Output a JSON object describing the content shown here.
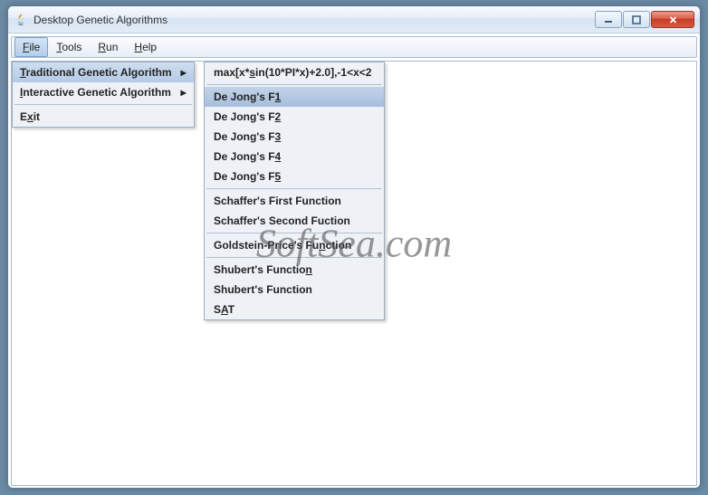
{
  "window": {
    "title": "Desktop Genetic Algorithms"
  },
  "menubar": {
    "items": [
      {
        "prefix": "",
        "ul": "F",
        "rest": "ile"
      },
      {
        "prefix": "",
        "ul": "T",
        "rest": "ools"
      },
      {
        "prefix": "",
        "ul": "R",
        "rest": "un"
      },
      {
        "prefix": "",
        "ul": "H",
        "rest": "elp"
      }
    ]
  },
  "file_menu": {
    "items": [
      {
        "prefix": "",
        "ul": "T",
        "rest": "raditional Genetic Algorithm",
        "has_submenu": true,
        "highlight": true
      },
      {
        "prefix": "",
        "ul": "I",
        "rest": "nteractive Genetic Algorithm",
        "has_submenu": true
      },
      {
        "sep": true
      },
      {
        "prefix": "E",
        "ul": "x",
        "rest": "it"
      }
    ]
  },
  "submenu": {
    "items": [
      {
        "prefix": "max[x*",
        "ul": "s",
        "rest": "in(10*PI*x)+2.0],-1<x<2"
      },
      {
        "sep": true
      },
      {
        "prefix": "De Jong's F",
        "ul": "1",
        "rest": "",
        "highlight": true
      },
      {
        "prefix": "De Jong's F",
        "ul": "2",
        "rest": ""
      },
      {
        "prefix": "De Jong's F",
        "ul": "3",
        "rest": ""
      },
      {
        "prefix": "De Jong's F",
        "ul": "4",
        "rest": ""
      },
      {
        "prefix": "De Jong's F",
        "ul": "5",
        "rest": ""
      },
      {
        "sep": true
      },
      {
        "prefix": "Schaffer's First Function",
        "ul": "",
        "rest": ""
      },
      {
        "prefix": "Schaffer's Second Fuction",
        "ul": "",
        "rest": ""
      },
      {
        "sep": true
      },
      {
        "prefix": "Goldstein-Price's Fu",
        "ul": "n",
        "rest": "ction"
      },
      {
        "sep": true
      },
      {
        "prefix": "Shubert's Functio",
        "ul": "n",
        "rest": ""
      },
      {
        "prefix": "Shubert's Function",
        "ul": "",
        "rest": ""
      },
      {
        "prefix": "S",
        "ul": "A",
        "rest": "T"
      }
    ]
  },
  "watermark": "SoftSea.com"
}
